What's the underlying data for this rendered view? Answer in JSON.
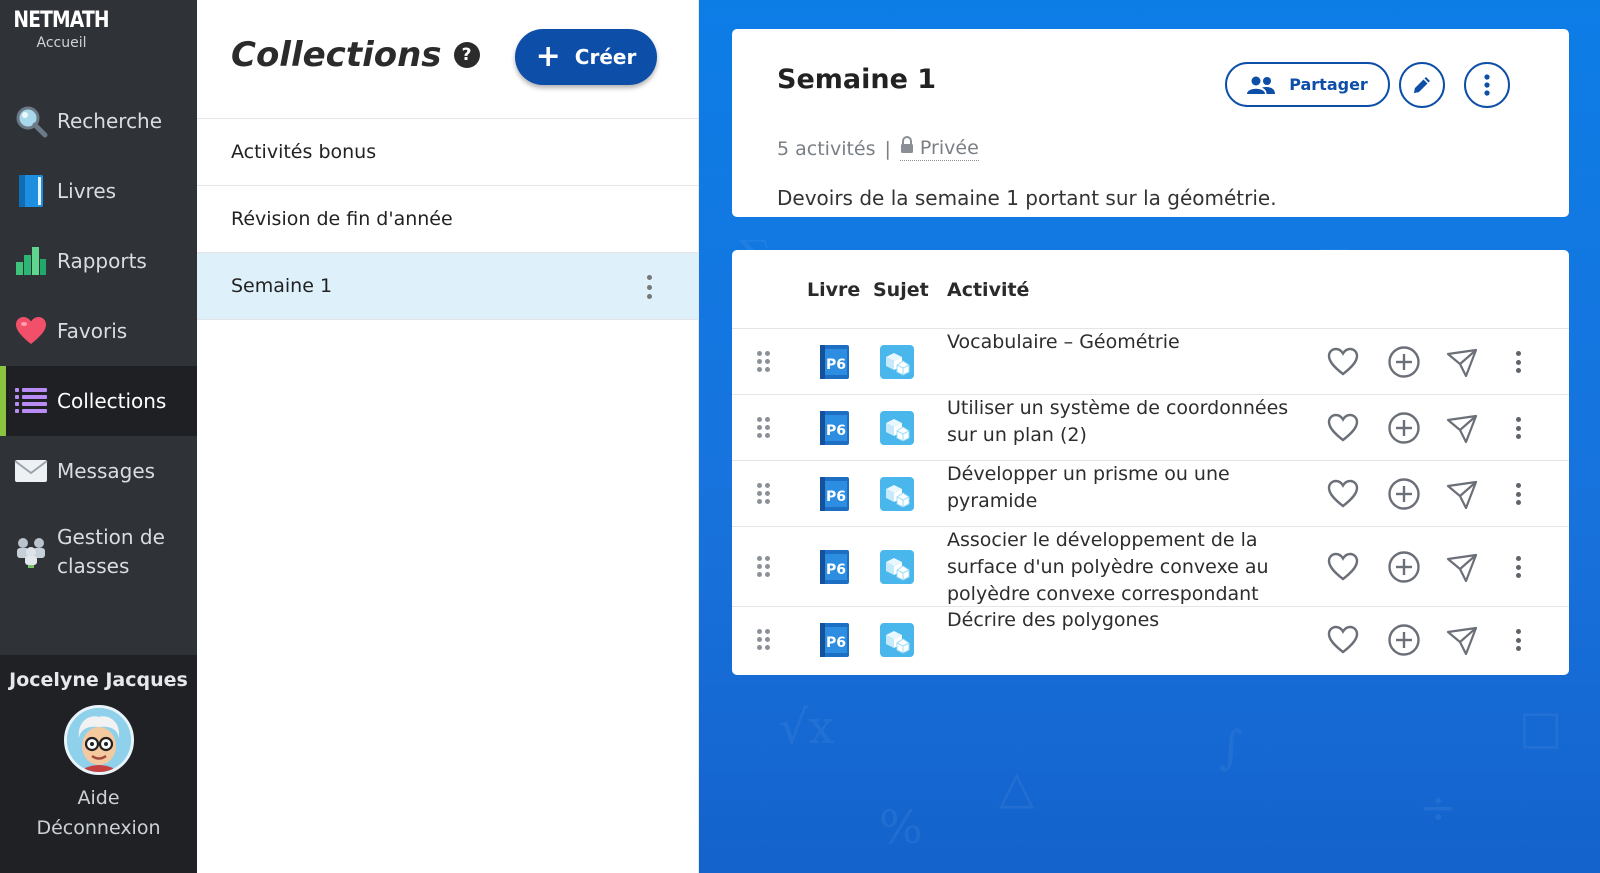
{
  "app": {
    "logo": "NETMATH",
    "home_label": "Accueil"
  },
  "nav": {
    "items": [
      {
        "key": "search",
        "label": "Recherche",
        "icon": "magnifier-icon"
      },
      {
        "key": "books",
        "label": "Livres",
        "icon": "book-icon"
      },
      {
        "key": "reports",
        "label": "Rapports",
        "icon": "bar-chart-icon"
      },
      {
        "key": "favorites",
        "label": "Favoris",
        "icon": "heart-icon"
      },
      {
        "key": "collections",
        "label": "Collections",
        "icon": "list-icon",
        "active": true
      },
      {
        "key": "messages",
        "label": "Messages",
        "icon": "envelope-icon"
      },
      {
        "key": "classes",
        "label": "Gestion de classes",
        "icon": "classroom-icon"
      }
    ]
  },
  "user": {
    "name": "Jocelyne Jacques",
    "help": "Aide",
    "logout": "Déconnexion"
  },
  "collections_panel": {
    "title": "Collections",
    "create_label": "Créer",
    "items": [
      {
        "label": "Activités bonus"
      },
      {
        "label": "Révision de fin d'année"
      },
      {
        "label": "Semaine 1",
        "selected": true
      }
    ]
  },
  "detail": {
    "title": "Semaine 1",
    "count": "5 activités",
    "separator": "|",
    "privacy": "Privée",
    "description": "Devoirs de la semaine 1 portant sur la géométrie.",
    "share_label": "Partager"
  },
  "table": {
    "headers": {
      "book": "Livre",
      "subject": "Sujet",
      "activity": "Activité"
    },
    "rows": [
      {
        "book": "P6",
        "subject": "geometry-solids-icon",
        "activity": "Vocabulaire – Géométrie"
      },
      {
        "book": "P6",
        "subject": "geometry-solids-icon",
        "activity": "Utiliser un système de coordonnées sur un plan (2)"
      },
      {
        "book": "P6",
        "subject": "geometry-solids-icon",
        "activity": "Développer un prisme ou une pyramide"
      },
      {
        "book": "P6",
        "subject": "geometry-solids-icon",
        "activity": "Associer le développement de la surface d'un polyèdre convexe au polyèdre convexe correspondant"
      },
      {
        "book": "P6",
        "subject": "geometry-solids-icon",
        "activity": "Décrire des polygones"
      }
    ]
  },
  "colors": {
    "sidebar_bg": "#2f3237",
    "active_accent": "#8bc53f",
    "primary": "#0d4fa8",
    "selected_row": "#def1fb",
    "main_bg": "#1872dc"
  }
}
